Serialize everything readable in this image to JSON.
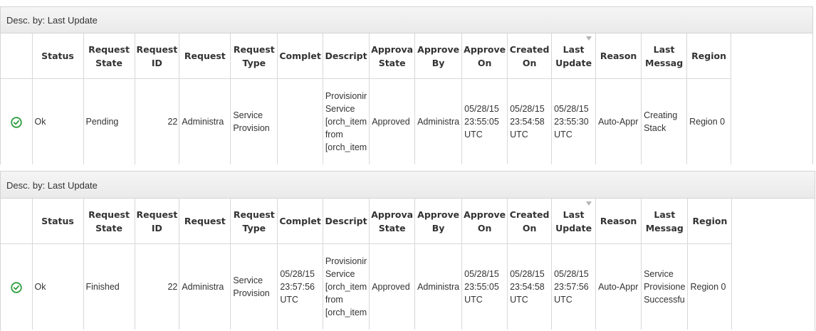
{
  "columns": [
    "",
    "Status",
    "Request State",
    "Request ID",
    "Request",
    "Request Type",
    "Complet",
    "Descript",
    "Approva State",
    "Approve By",
    "Approve On",
    "Created On",
    "Last Update",
    "Reason",
    "Last Messag",
    "Region"
  ],
  "status_icon": "check-circle-icon",
  "accent_color": "#2e9e3e",
  "panels": [
    {
      "caption": "Desc. by: Last Update",
      "row": {
        "status": "Ok",
        "request_state": "Pending",
        "request_id": "22",
        "request": "Administra",
        "request_type": [
          "Service",
          "Provision"
        ],
        "completed": [],
        "description": [
          "Provisionir",
          "Service",
          "[orch_item",
          "from",
          "[orch_item"
        ],
        "approval_state": "Approved",
        "approved_by": "Administra",
        "approved_on": [
          "05/28/15",
          "23:55:05",
          "UTC"
        ],
        "created_on": [
          "05/28/15",
          "23:54:58",
          "UTC"
        ],
        "last_update": [
          "05/28/15",
          "23:55:30",
          "UTC"
        ],
        "reason": "Auto-Appr",
        "last_message": [
          "Creating",
          "Stack"
        ],
        "region": "Region 0"
      }
    },
    {
      "caption": "Desc. by: Last Update",
      "row": {
        "status": "Ok",
        "request_state": "Finished",
        "request_id": "22",
        "request": "Administra",
        "request_type": [
          "Service",
          "Provision"
        ],
        "completed": [
          "05/28/15",
          "23:57:56",
          "UTC"
        ],
        "description": [
          "Provisionir",
          "Service",
          "[orch_item",
          "from",
          "[orch_item"
        ],
        "approval_state": "Approved",
        "approved_by": "Administra",
        "approved_on": [
          "05/28/15",
          "23:55:05",
          "UTC"
        ],
        "created_on": [
          "05/28/15",
          "23:54:58",
          "UTC"
        ],
        "last_update": [
          "05/28/15",
          "23:57:56",
          "UTC"
        ],
        "reason": "Auto-Appr",
        "last_message": [
          "Service",
          "Provisione",
          "Successfu"
        ],
        "region": "Region 0"
      }
    }
  ]
}
